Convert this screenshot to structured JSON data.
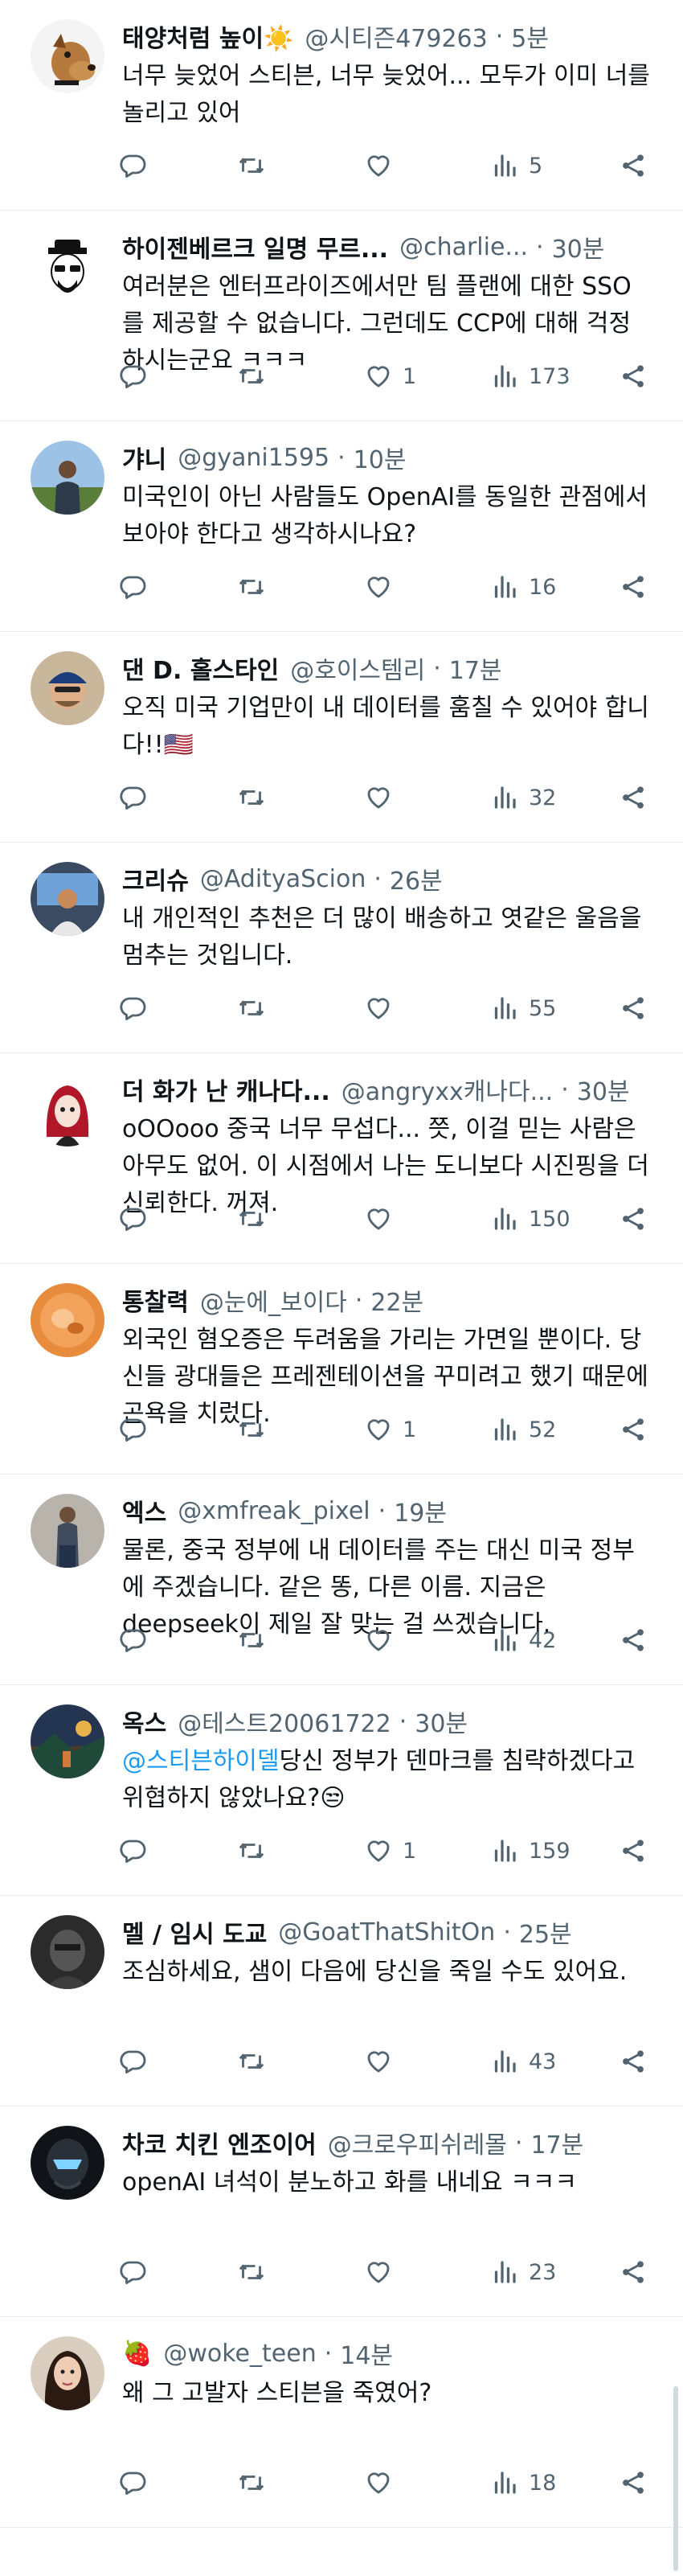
{
  "tweets": [
    {
      "name": "태양처럼 높이☀️",
      "handle": "@시티즌479263",
      "time": "5분",
      "text": "너무 늦었어 스티븐, 너무 늦었어... 모두가 이미 너를 놀리고 있어",
      "reply_count": "",
      "retweet_count": "",
      "like_count": "",
      "view_count": "5",
      "avatar": "dog"
    },
    {
      "name": "하이젠베르크 일명 무르...",
      "handle": "@charlie...",
      "time": "30분",
      "text": "여러분은 엔터프라이즈에서만 팀 플랜에 대한 SSO를 제공할 수 없습니다. 그런데도 CCP에 대해 걱정하시는군요 ㅋㅋㅋ",
      "reply_count": "",
      "retweet_count": "",
      "like_count": "1",
      "view_count": "173",
      "avatar": "heisenberg"
    },
    {
      "name": "갸니",
      "handle": "@gyani1595",
      "time": "10분",
      "text": "미국인이 아닌 사람들도 OpenAI를 동일한 관점에서 보아야 한다고 생각하시나요?",
      "reply_count": "",
      "retweet_count": "",
      "like_count": "",
      "view_count": "16",
      "avatar": "outdoor"
    },
    {
      "name": "댄 D. 홀스타인",
      "handle": "@호이스템리",
      "time": "17분",
      "text": "오직 미국 기업만이 내 데이터를 훔칠 수 있어야 합니다!!🇺🇸",
      "reply_count": "",
      "retweet_count": "",
      "like_count": "",
      "view_count": "32",
      "avatar": "man-cap"
    },
    {
      "name": "크리슈",
      "handle": "@AdityaScion",
      "time": "26분",
      "text": "내 개인적인 추천은 더 많이 배송하고 엿같은 울음을 멈추는 것입니다.",
      "reply_count": "",
      "retweet_count": "",
      "like_count": "",
      "view_count": "55",
      "avatar": "desk"
    },
    {
      "name": "더 화가 난 캐나다...",
      "handle": "@angryxx캐나다...",
      "time": "30분",
      "text": "oOOooo 중국 너무 무섭다... 쯧, 이걸 믿는 사람은 아무도 없어. 이 시점에서 나는 도니보다 시진핑을 더 신뢰한다. 꺼져.",
      "reply_count": "",
      "retweet_count": "",
      "like_count": "",
      "view_count": "150",
      "avatar": "anime-red"
    },
    {
      "name": "통찰력",
      "handle": "@눈에_보이다",
      "time": "22분",
      "text": "외국인 혐오증은 두려움을 가리는 가면일 뿐이다. 당신들 광대들은 프레젠테이션을 꾸미려고 했기 때문에 곤욕을 치렀다.",
      "reply_count": "",
      "retweet_count": "",
      "like_count": "1",
      "view_count": "52",
      "avatar": "orange"
    },
    {
      "name": "엑스",
      "handle": "@xmfreak_pixel",
      "time": "19분",
      "text": "물론, 중국 정부에 내 데이터를 주는 대신 미국 정부에 주겠습니다. 같은 똥, 다른 이름. 지금은 deepseek이 제일 잘 맞는 걸 쓰겠습니다.",
      "reply_count": "",
      "retweet_count": "",
      "like_count": "",
      "view_count": "42",
      "avatar": "person-street"
    },
    {
      "name": "옥스",
      "handle": "@테스트20061722",
      "time": "30분",
      "mention": "@스티븐하이델",
      "text": "당신 정부가 덴마크를 침략하겠다고 위협하지 않았나요?😒",
      "reply_count": "",
      "retweet_count": "",
      "like_count": "1",
      "view_count": "159",
      "avatar": "landscape"
    },
    {
      "name": "멜 / 임시 도교",
      "handle": "@GoatThatShitOn",
      "time": "25분",
      "text": "조심하세요, 샘이 다음에 당신을 죽일 수도 있어요.",
      "reply_count": "",
      "retweet_count": "",
      "like_count": "",
      "view_count": "43",
      "avatar": "dark"
    },
    {
      "name": "차코 치킨 엔조이어",
      "handle": "@크로우피쉬레몰",
      "time": "17분",
      "text": "openAI 녀석이 분노하고 화를 내네요 ㅋㅋㅋ",
      "reply_count": "",
      "retweet_count": "",
      "like_count": "",
      "view_count": "23",
      "avatar": "helmet"
    },
    {
      "name": "🍓",
      "handle": "@woke_teen",
      "time": "14분",
      "text": "왜 그 고발자 스티븐을 죽였어?",
      "reply_count": "",
      "retweet_count": "",
      "like_count": "",
      "view_count": "18",
      "avatar": "woman"
    }
  ],
  "colors": {
    "text": "#0f1419",
    "secondary": "#536471",
    "accent": "#1d9bf0",
    "divider": "#e6ecf0"
  }
}
